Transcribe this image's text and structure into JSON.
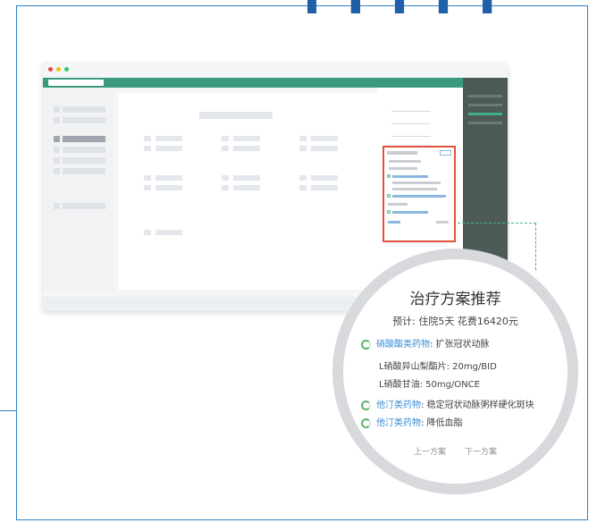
{
  "colors": {
    "brand_green": "#3a9a7f",
    "dark_panel": "#4d5a58",
    "highlight_border": "#e0533a",
    "link_blue": "#3a8fd6",
    "frame_blue": "#2f7fc1",
    "ring_green": "#5db36c"
  },
  "window": {
    "dots": [
      "#e74c3c",
      "#f1c40f",
      "#2ecc71"
    ]
  },
  "recommendation": {
    "title": "治疗方案推荐",
    "estimate": "预计: 住院5天  花费16420元",
    "items": [
      {
        "category": "硝酸酯类药物",
        "desc": ": 扩张冠状动脉",
        "subitems": [
          "L硝酸异山梨酯片: 20mg/BID",
          "L硝酸甘油: 50mg/ONCE"
        ]
      },
      {
        "category": "他汀类药物",
        "desc": ": 稳定冠状动脉粥样硬化斑块",
        "subitems": []
      },
      {
        "category": "他汀类药物",
        "desc": ": 降低血脂",
        "subitems": []
      }
    ],
    "prev_label": "上一方案",
    "next_label": "下一方案"
  },
  "icons": {
    "progress_ring": "progress-ring-icon"
  }
}
